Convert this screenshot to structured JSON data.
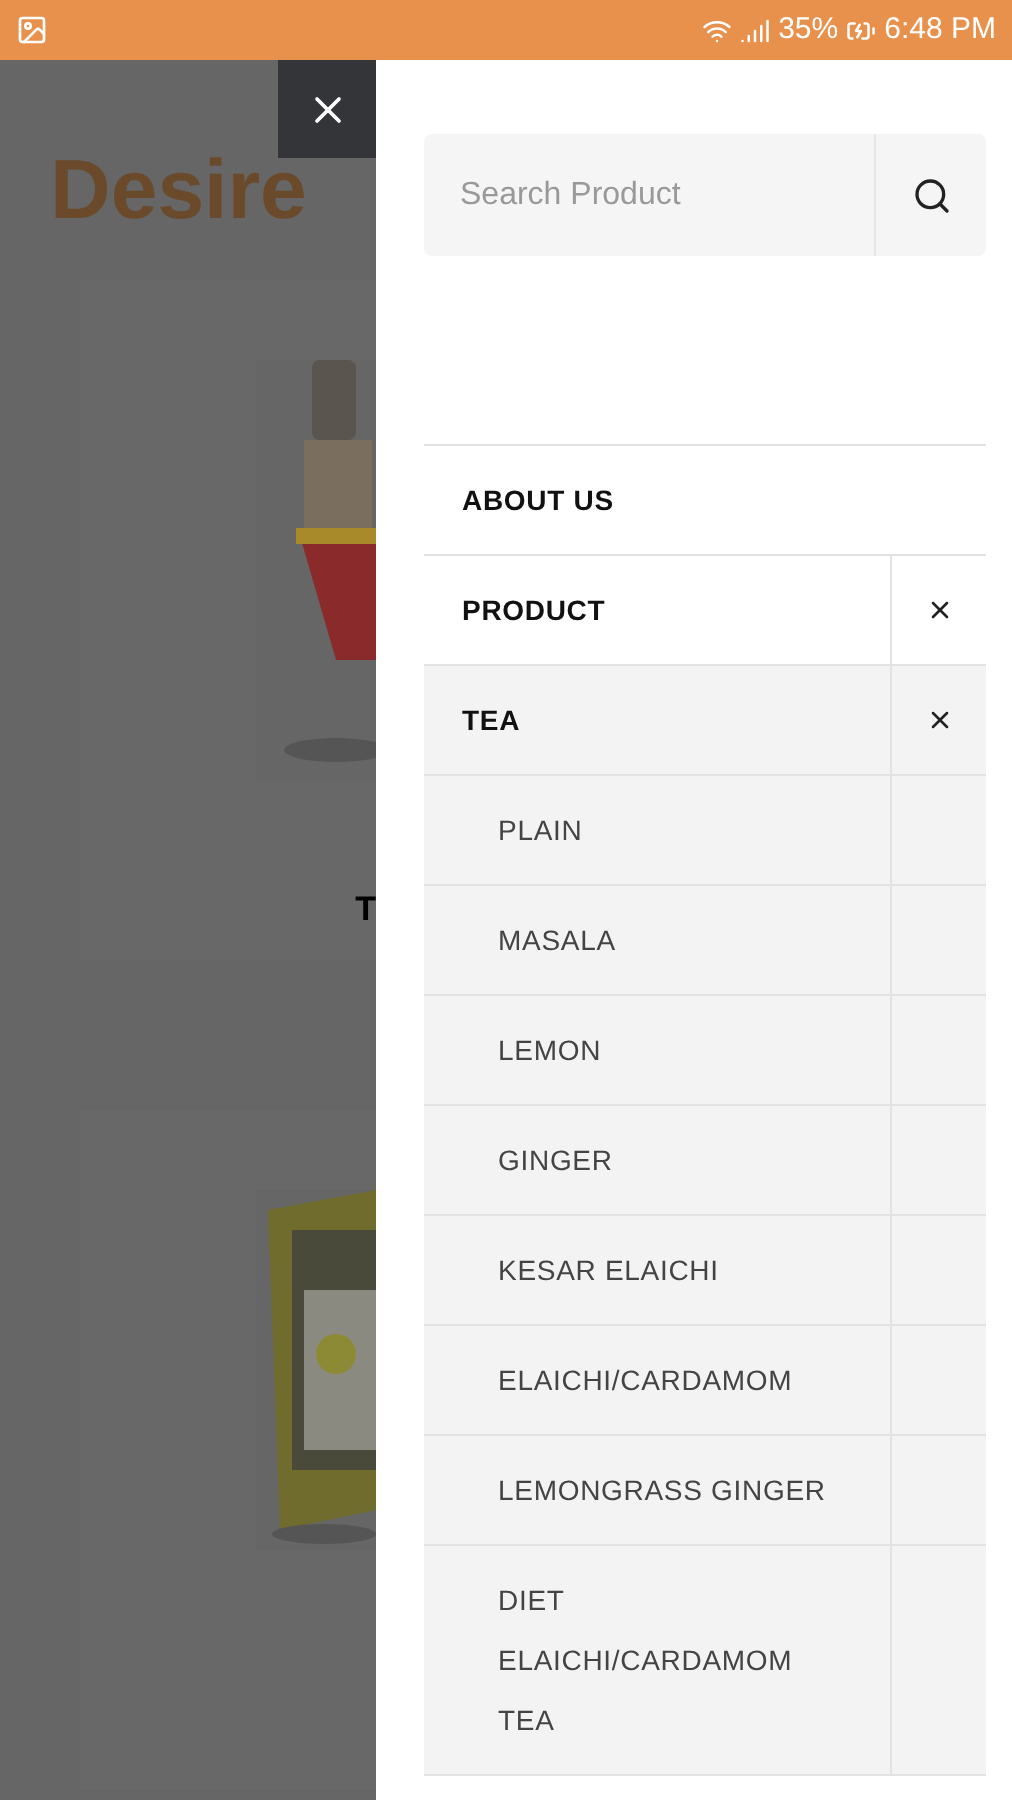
{
  "status_bar": {
    "battery": "35%",
    "time": "6:48 PM"
  },
  "background_page": {
    "logo": "Desire",
    "products": [
      {
        "kind": "bottle",
        "title": "T"
      },
      {
        "kind": "bag"
      }
    ]
  },
  "search": {
    "placeholder": "Search Product"
  },
  "menu": [
    {
      "label": "ABOUT US"
    },
    {
      "label": "PRODUCT",
      "expanded": true,
      "children": [
        {
          "label": "TEA",
          "expanded": true,
          "children": [
            {
              "label": "PLAIN"
            },
            {
              "label": "MASALA"
            },
            {
              "label": "LEMON"
            },
            {
              "label": "GINGER"
            },
            {
              "label": "KESAR ELAICHI"
            },
            {
              "label": "ELAICHI/CARDAMOM"
            },
            {
              "label": "LEMONGRASS GINGER"
            },
            {
              "label": "DIET ELAICHI/CARDAMOM TEA"
            }
          ]
        }
      ]
    }
  ]
}
